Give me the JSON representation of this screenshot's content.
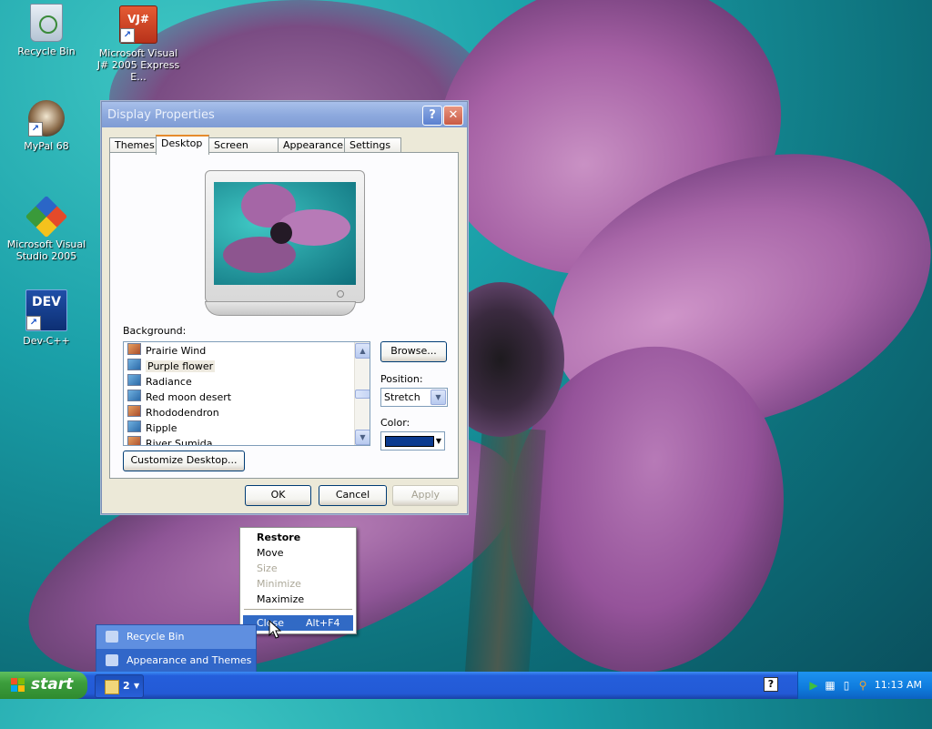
{
  "desktop": {
    "icons": [
      {
        "label": "Recycle Bin"
      },
      {
        "label": "Microsoft Visual J# 2005 Express E..."
      },
      {
        "label": "MyPal 68"
      },
      {
        "label": "Microsoft Visual Studio 2005"
      },
      {
        "label": "Dev-C++"
      }
    ],
    "dev_icon_text": "DEV",
    "vj_icon_text": "VJ#"
  },
  "window": {
    "title": "Display Properties",
    "help_glyph": "?",
    "close_glyph": "✕",
    "tabs": [
      "Themes",
      "Desktop",
      "Screen Saver",
      "Appearance",
      "Settings"
    ],
    "active_tab": "Desktop",
    "background_label": "Background:",
    "background_items": [
      {
        "label": "Prairie Wind",
        "icon": "warm"
      },
      {
        "label": "Purple flower",
        "icon": "cool",
        "selected": true
      },
      {
        "label": "Radiance",
        "icon": "cool"
      },
      {
        "label": "Red moon desert",
        "icon": "cool"
      },
      {
        "label": "Rhododendron",
        "icon": "warm"
      },
      {
        "label": "Ripple",
        "icon": "cool"
      },
      {
        "label": "River Sumida",
        "icon": "warm"
      }
    ],
    "browse_label": "Browse...",
    "position_label": "Position:",
    "position_value": "Stretch",
    "color_label": "Color:",
    "color_value": "#0a3a8f",
    "customize_label": "Customize Desktop...",
    "ok_label": "OK",
    "cancel_label": "Cancel",
    "apply_label": "Apply"
  },
  "context_menu": {
    "items": [
      {
        "label": "Restore",
        "bold": true
      },
      {
        "label": "Move"
      },
      {
        "label": "Size",
        "disabled": true
      },
      {
        "label": "Minimize",
        "disabled": true
      },
      {
        "label": "Maximize"
      },
      {
        "label": "Close",
        "shortcut": "Alt+F4",
        "highlighted": true
      }
    ]
  },
  "taskbar_popup": {
    "items": [
      "Recycle Bin",
      "Appearance and Themes"
    ]
  },
  "taskbar": {
    "start_label": "start",
    "group_count": "2",
    "help_glyph": "?",
    "clock": "11:13 AM"
  },
  "colors": {
    "title_blue": "#8eaade",
    "selection": "#316ac5",
    "taskbar": "#245edb",
    "start_green": "#3c9e3c"
  }
}
